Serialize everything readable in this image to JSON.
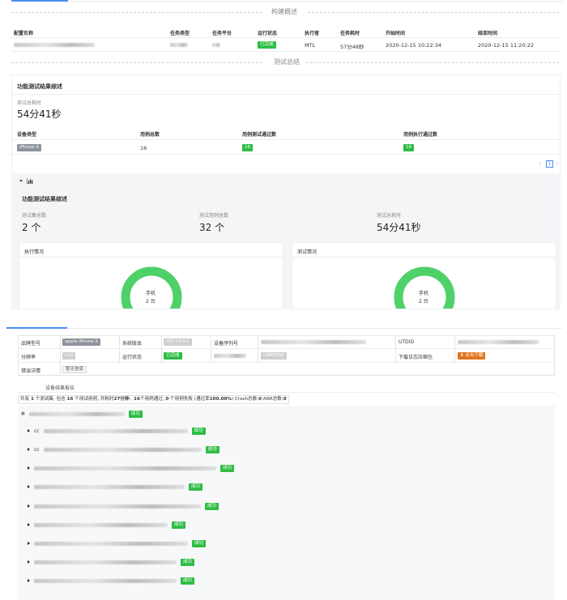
{
  "build_overview": {
    "title": "构建概述",
    "headers": [
      "配置名称",
      "任务类型",
      "任务平台",
      "运行状态",
      "执行者",
      "任务耗时",
      "开始时间",
      "结束时间"
    ],
    "row": {
      "status": "已完成",
      "executor": "MTL",
      "duration": "57分48秒",
      "start": "2020-12-15 10:22:34",
      "end": "2020-12-15 11:20:22"
    }
  },
  "test_summary": {
    "title": "测试总结",
    "functional_title": "功能测试结果综述",
    "total_time_label": "测试总耗时",
    "total_time_value": "54分41秒",
    "device_table": {
      "headers": [
        "设备类型",
        "用例总数",
        "用例测试通过数",
        "用例执行通过数"
      ],
      "row": {
        "device": "iPhone X",
        "total": "16",
        "passed": "16",
        "executed": "16"
      }
    },
    "pager": {
      "prev": "‹",
      "page": "1",
      "next": "›"
    }
  },
  "panel": {
    "title": "功能测试结果综述",
    "stats": [
      {
        "label": "测试集总数",
        "value": "2 个"
      },
      {
        "label": "测试用例总数",
        "value": "32 个"
      },
      {
        "label": "测试总耗时",
        "value": "54分41秒"
      }
    ],
    "cards": [
      {
        "title": "执行情况",
        "center_top": "手机",
        "center_bottom": "2 台"
      },
      {
        "title": "测试情况",
        "center_top": "手机",
        "center_bottom": "2 台"
      }
    ],
    "ring_color": "#4fd16a"
  },
  "device_info": {
    "rows": [
      {
        "l1": "品牌型号",
        "v1": "apple iPhone X",
        "l2": "系统版本",
        "v2": "iOS 13.4.1",
        "l3": "设备序列号",
        "l4": "UTDID"
      },
      {
        "l1": "分辨率",
        "v1": "null",
        "l2": "运行状态",
        "v2": "已完成",
        "v3": "UNKNOW",
        "l4": "下载日志压缩包",
        "v4": "⬇ 点击下载"
      },
      {
        "l1": "错误详情",
        "v1": "暂无信息"
      }
    ]
  },
  "report": {
    "tab": "设备结果报告",
    "summary_parts": [
      "共有 ",
      "1",
      " 个测试集, 包含 ",
      "16",
      " 个测试用例, 共耗时",
      "27分钟",
      "。",
      "16",
      "个用例通过, ",
      "0",
      " 个用例失败 (通过率",
      "100.00%",
      ") Crash总数:",
      "0",
      " ANR总数:",
      "0"
    ],
    "root_status": "成功",
    "items": [
      {
        "prefix": "cc",
        "status": "成功"
      },
      {
        "prefix": "cc",
        "status": "成功"
      },
      {
        "prefix": "",
        "status": "成功"
      },
      {
        "prefix": "",
        "status": "成功"
      },
      {
        "prefix": "",
        "status": "成功"
      },
      {
        "prefix": "",
        "status": "成功"
      },
      {
        "prefix": "",
        "status": "成功"
      },
      {
        "prefix": "",
        "status": "成功"
      },
      {
        "prefix": "",
        "status": "成功"
      }
    ]
  }
}
